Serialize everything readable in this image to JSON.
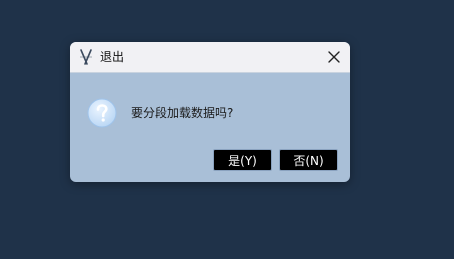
{
  "dialog": {
    "title": "退出",
    "app_icon": "app-logo-icon",
    "close_icon": "close-icon",
    "question_icon": "question-icon",
    "message": "要分段加载数据吗?",
    "buttons": {
      "yes_label": "是(Y)",
      "no_label": "否(N)"
    }
  },
  "colors": {
    "desktop_background": "#1f3249",
    "dialog_body": "#a9bfd7",
    "titlebar": "#f1f1f4",
    "button_background": "#000000",
    "button_text": "#ffffff"
  }
}
